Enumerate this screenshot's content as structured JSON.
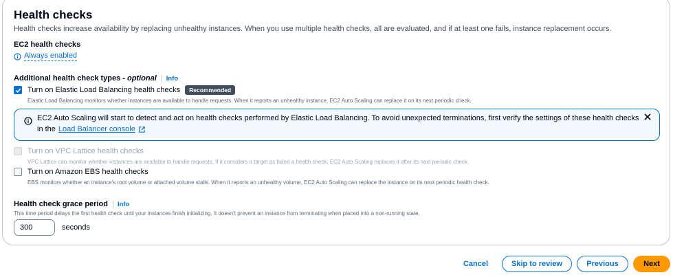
{
  "section": {
    "title": "Health checks",
    "description": "Health checks increase availability by replacing unhealthy instances. When you use multiple health checks, all are evaluated, and if at least one fails, instance replacement occurs."
  },
  "ec2": {
    "label": "EC2 health checks",
    "value": "Always enabled"
  },
  "additional": {
    "label": "Additional health check types",
    "optional": "- optional",
    "info": "Info"
  },
  "elb": {
    "checked": true,
    "label": "Turn on Elastic Load Balancing health checks",
    "badge": "Recommended",
    "description": "Elastic Load Balancing monitors whether instances are available to handle requests. When it reports an unhealthy instance, EC2 Auto Scaling can replace it on its next periodic check."
  },
  "alert": {
    "text_line1": "EC2 Auto Scaling will start to detect and act on health checks performed by Elastic Load Balancing. To avoid unexpected terminations, first verify the settings of these health checks",
    "text_prefix": "in the",
    "link": "Load Balancer console"
  },
  "vpc": {
    "checked": false,
    "disabled": true,
    "label": "Turn on VPC Lattice health checks",
    "description": "VPC Lattice can monitor whether instances are available to handle requests. If it considers a target as failed a health check, EC2 Auto Scaling replaces it after its next periodic check."
  },
  "ebs": {
    "checked": false,
    "label": "Turn on Amazon EBS health checks",
    "description": "EBS monitors whether an instance's root volume or attached volume stalls. When it reports an unhealthy volume, EC2 Auto Scaling can replace the instance on its next periodic health check."
  },
  "grace": {
    "label": "Health check grace period",
    "info": "Info",
    "description": "This time period delays the first health check until your instances finish initializing. It doesn't prevent an instance from terminating when placed into a non-running state.",
    "value": "300",
    "unit": "seconds"
  },
  "footer": {
    "cancel": "Cancel",
    "skip": "Skip to review",
    "previous": "Previous",
    "next": "Next"
  },
  "colors": {
    "accent": "#0972d3",
    "primary_button": "#ff9900",
    "alert_bg": "#f2f8fd"
  }
}
